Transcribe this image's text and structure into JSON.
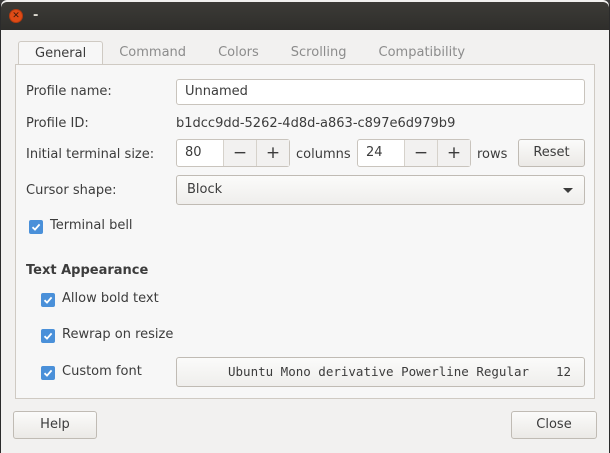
{
  "window": {
    "title": "-"
  },
  "tabs": [
    {
      "label": "General",
      "active": true
    },
    {
      "label": "Command",
      "active": false
    },
    {
      "label": "Colors",
      "active": false
    },
    {
      "label": "Scrolling",
      "active": false
    },
    {
      "label": "Compatibility",
      "active": false
    }
  ],
  "general": {
    "profile_name_label": "Profile name:",
    "profile_name_value": "Unnamed",
    "profile_id_label": "Profile ID:",
    "profile_id_value": "b1dcc9dd-5262-4d8d-a863-c897e6d979b9",
    "terminal_size_label": "Initial terminal size:",
    "columns_value": "80",
    "columns_label": "columns",
    "rows_value": "24",
    "rows_label": "rows",
    "reset_label": "Reset",
    "minus_glyph": "−",
    "plus_glyph": "+",
    "cursor_shape_label": "Cursor shape:",
    "cursor_shape_value": "Block",
    "terminal_bell_label": "Terminal bell",
    "terminal_bell_checked": true
  },
  "text_appearance": {
    "heading": "Text Appearance",
    "allow_bold_label": "Allow bold text",
    "allow_bold_checked": true,
    "rewrap_label": "Rewrap on resize",
    "rewrap_checked": true,
    "custom_font_label": "Custom font",
    "custom_font_checked": true,
    "font_name": "Ubuntu Mono derivative Powerline Regular",
    "font_size": "12"
  },
  "footer": {
    "help_label": "Help",
    "close_label": "Close"
  },
  "colors": {
    "accent": "#4a90d9",
    "close_button": "#df4b16",
    "titlebar": "#3c3b37"
  }
}
